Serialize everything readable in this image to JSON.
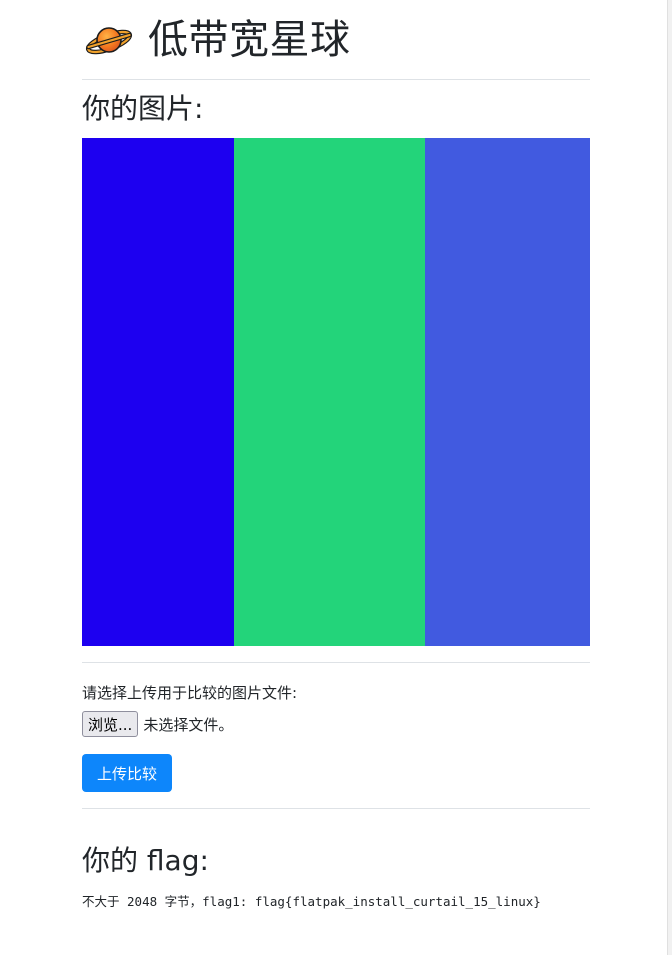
{
  "header": {
    "icon": "planet-emoji-icon",
    "title": "低带宽星球"
  },
  "image_section": {
    "title": "你的图片:",
    "stripes": [
      {
        "color": "#1d00f0",
        "fraction": 0.2992
      },
      {
        "color": "#23d47a",
        "fraction": 0.376
      },
      {
        "color": "#415ae0",
        "fraction": 0.3248
      }
    ]
  },
  "upload": {
    "prompt": "请选择上传用于比较的图片文件:",
    "browse_label": "浏览...",
    "file_status": "未选择文件。",
    "submit_label": "上传比较"
  },
  "flag_section": {
    "title": "你的 flag:",
    "text": "不大于 2048 字节，flag1: flag{flatpak_install_curtail_15_linux}"
  }
}
